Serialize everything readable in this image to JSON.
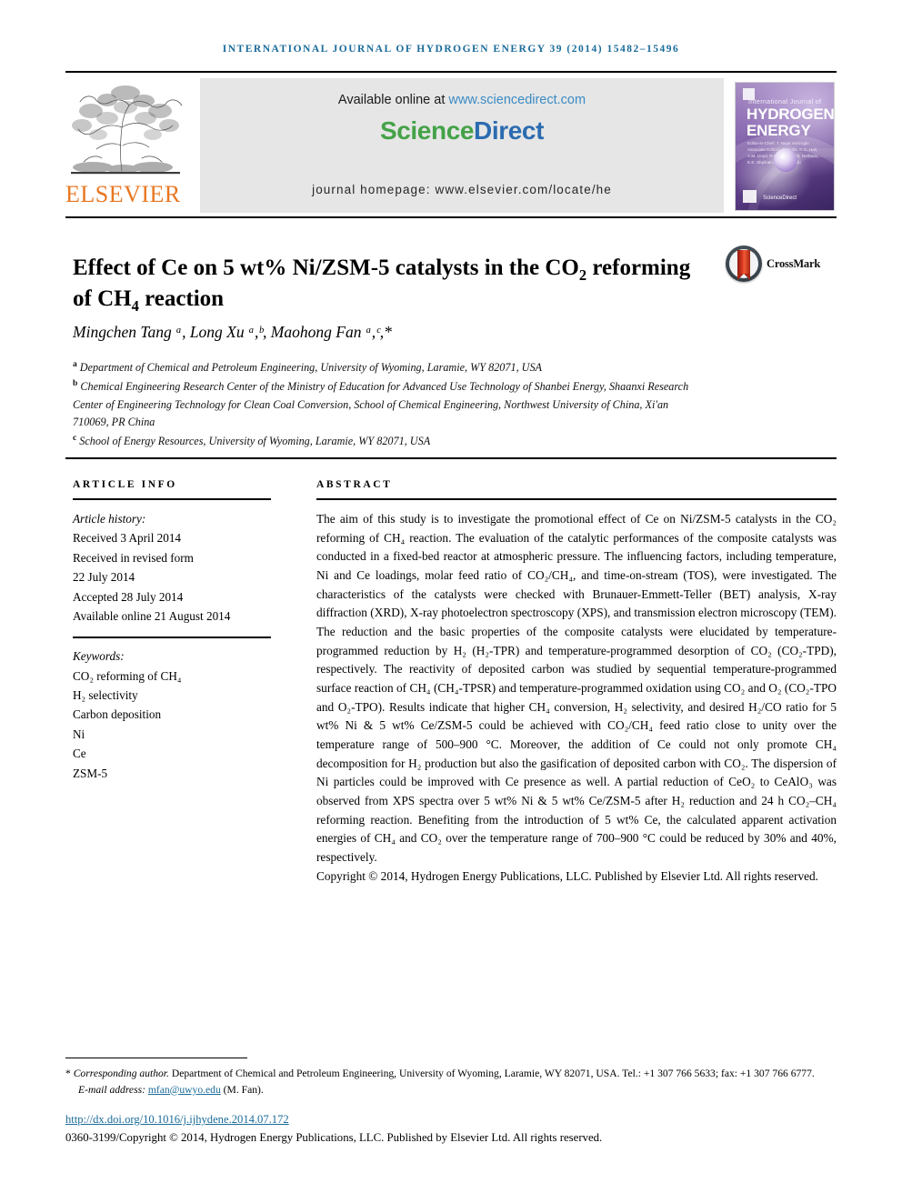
{
  "running_head": "International Journal of Hydrogen Energy 39 (2014) 15482–15496",
  "masthead": {
    "publisher_name": "ELSEVIER",
    "available_prefix": "Available online at ",
    "available_link": "www.sciencedirect.com",
    "sciencedirect_part1": "Science",
    "sciencedirect_part2": "Direct",
    "journal_homepage": "journal homepage: www.elsevier.com/locate/he",
    "cover": {
      "small_top": "International Journal of",
      "head_line1": "HYDROGEN",
      "head_line2": "ENERGY",
      "editor_lines": "Editor-in-Chief: T. Nejat Veziroglu    Associate Editors: S. Dutta, D.O. Hall, A.M. Lloyd, R.O. Loutfy, J.M. Norbeck, E.E. Shpilrain, T.N. Veziroglu",
      "footer_text": "ScienceDirect"
    }
  },
  "article": {
    "title_line1": "Effect of Ce on 5 wt% Ni/ZSM-5 catalysts in the CO",
    "title_sub1": "2",
    "title_line2": "reforming of CH",
    "title_sub2": "4",
    "title_line3": " reaction",
    "crossmark_label": "CrossMark",
    "authors": "Mingchen Tang ᵃ, Long Xu ᵃ,ᵇ, Maohong Fan ᵃ,ᶜ,*",
    "affiliations": [
      "Department of Chemical and Petroleum Engineering, University of Wyoming, Laramie, WY 82071, USA",
      "Chemical Engineering Research Center of the Ministry of Education for Advanced Use Technology of Shanbei Energy, Shaanxi Research Center of Engineering Technology for Clean Coal Conversion, School of Chemical Engineering, Northwest University of China, Xi'an 710069, PR China",
      "School of Energy Resources, University of Wyoming, Laramie, WY 82071, USA"
    ],
    "affiliation_marks": [
      "a",
      "b",
      "c"
    ]
  },
  "article_info": {
    "heading": "ARTICLE INFO",
    "history_label": "Article history:",
    "history_lines": [
      "Received 3 April 2014",
      "Received in revised form",
      "22 July 2014",
      "Accepted 28 July 2014",
      "Available online 21 August 2014"
    ],
    "keywords_label": "Keywords:",
    "keywords": [
      "CO₂ reforming of CH₄",
      "H₂ selectivity",
      "Carbon deposition",
      "Ni",
      "Ce",
      "ZSM-5"
    ]
  },
  "abstract": {
    "heading": "ABSTRACT",
    "body": "The aim of this study is to investigate the promotional effect of Ce on Ni/ZSM-5 catalysts in the CO₂ reforming of CH₄ reaction. The evaluation of the catalytic performances of the composite catalysts was conducted in a fixed-bed reactor at atmospheric pressure. The influencing factors, including temperature, Ni and Ce loadings, molar feed ratio of CO₂/CH₄, and time-on-stream (TOS), were investigated. The characteristics of the catalysts were checked with Brunauer-Emmett-Teller (BET) analysis, X-ray diffraction (XRD), X-ray photoelectron spectroscopy (XPS), and transmission electron microscopy (TEM). The reduction and the basic properties of the composite catalysts were elucidated by temperature-programmed reduction by H₂ (H₂-TPR) and temperature-programmed desorption of CO₂ (CO₂-TPD), respectively. The reactivity of deposited carbon was studied by sequential temperature-programmed surface reaction of CH₄ (CH₄-TPSR) and temperature-programmed oxidation using CO₂ and O₂ (CO₂-TPO and O₂-TPO). Results indicate that higher CH₄ conversion, H₂ selectivity, and desired H₂/CO ratio for 5 wt% Ni & 5 wt% Ce/ZSM-5 could be achieved with CO₂/CH₄ feed ratio close to unity over the temperature range of 500–900 °C. Moreover, the addition of Ce could not only promote CH₄ decomposition for H₂ production but also the gasification of deposited carbon with CO₂. The dispersion of Ni particles could be improved with Ce presence as well. A partial reduction of CeO₂ to CeAlO₃ was observed from XPS spectra over 5 wt% Ni & 5 wt% Ce/ZSM-5 after H₂ reduction and 24 h CO₂–CH₄ reforming reaction. Benefiting from the introduction of 5 wt% Ce, the calculated apparent activation energies of CH₄ and CO₂ over the temperature range of 700–900 °C could be reduced by 30% and 40%, respectively.",
    "copyright": "Copyright © 2014, Hydrogen Energy Publications, LLC. Published by Elsevier Ltd. All rights reserved."
  },
  "footer": {
    "corresponding_star": "*",
    "corresponding_label": "Corresponding author.",
    "corresponding_text": " Department of Chemical and Petroleum Engineering, University of Wyoming, Laramie, WY 82071, USA. Tel.: +1 307 766 5633; fax: +1 307 766 6777.",
    "email_label": "E-mail address: ",
    "email_address": "mfan@uwyo.edu",
    "email_suffix": " (M. Fan).",
    "doi": "http://dx.doi.org/10.1016/j.ijhydene.2014.07.172",
    "issn_line": "0360-3199/Copyright © 2014, Hydrogen Energy Publications, LLC. Published by Elsevier Ltd. All rights reserved."
  },
  "colors": {
    "running_head": "#1a6b9a",
    "elsevier_orange": "#E87722",
    "sciencedirect_green": "#44a248",
    "link_blue": "#3b8bc4",
    "sup_blue": "#2b7bb9"
  }
}
